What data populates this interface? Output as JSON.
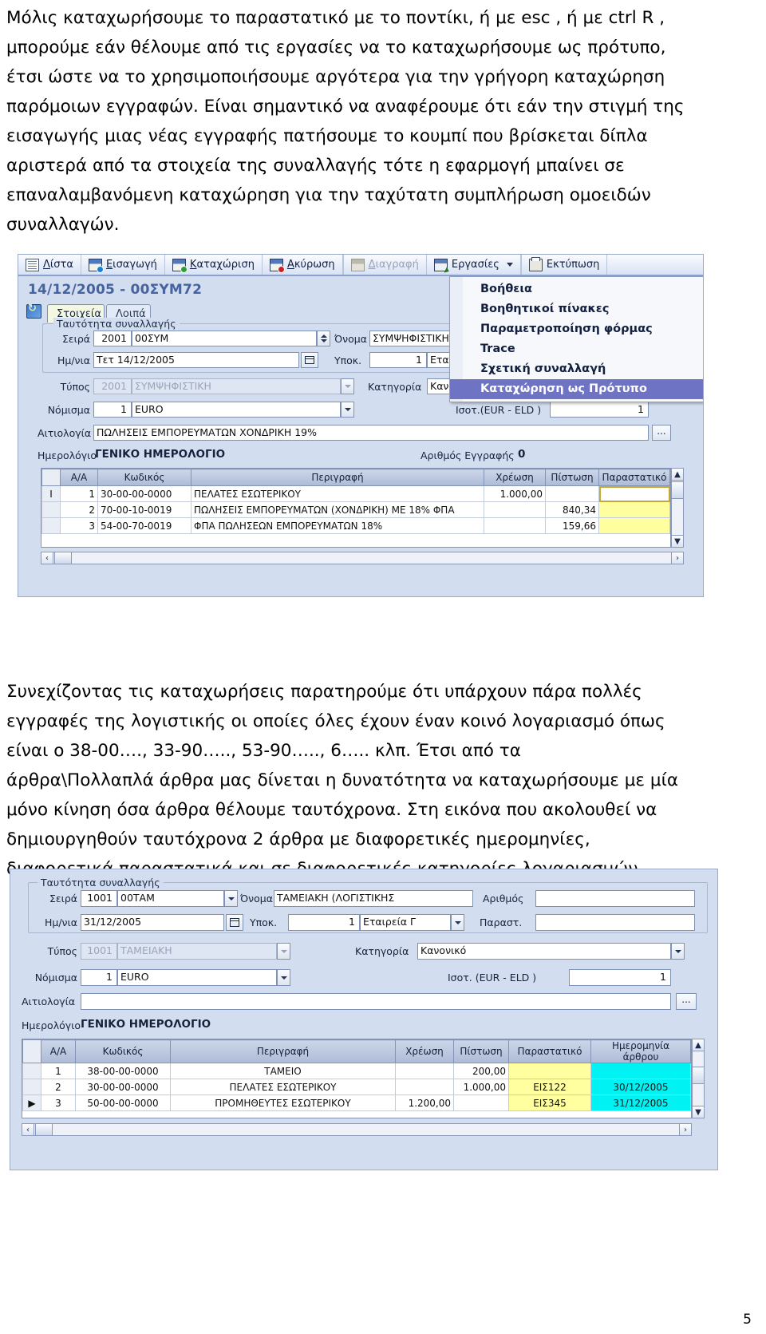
{
  "document": {
    "page_number": "5",
    "paragraph_1": [
      "Μόλις καταχωρήσουμε το παραστατικό με το ποντίκι, ή με esc , ή με ctrl R ,",
      "μπορούμε εάν θέλουμε από τις εργασίες να το καταχωρήσουμε ως πρότυπο,",
      "έτσι ώστε να το χρησιμοποιήσουμε αργότερα για την γρήγορη καταχώρηση",
      "παρόμοιων εγγραφών. Είναι σημαντικό να αναφέρουμε ότι εάν την στιγμή της",
      "εισαγωγής μιας νέας εγγραφής πατήσουμε το κουμπί που βρίσκεται δίπλα",
      "αριστερά από τα στοιχεία της συναλλαγής τότε η εφαρμογή μπαίνει σε",
      "επαναλαμβανόμενη καταχώρηση για την ταχύτατη συμπλήρωση ομοειδών",
      "συναλλαγών."
    ],
    "paragraph_2": [
      "Συνεχίζοντας τις καταχωρήσεις παρατηρούμε ότι υπάρχουν πάρα πολλές",
      "εγγραφές της λογιστικής οι οποίες όλες έχουν έναν κοινό λογαριασμό όπως",
      "είναι ο 38-00…., 33-90….., 53-90….., 6….. κλπ. Έτσι από τα",
      "άρθρα\\Πολλαπλά άρθρα μας δίνεται η δυνατότητα να καταχωρήσουμε με μία",
      "μόνο κίνηση όσα άρθρα θέλουμε ταυτόχρονα. Στη εικόνα που ακολουθεί να",
      "δημιουργηθούν ταυτόχρονα 2 άρθρα με διαφορετικές ημερομηνίες,",
      "διαφορετικά παραστατικά και σε διαφορετικές κατηγορίες λογαριασμών."
    ]
  },
  "screenshot1": {
    "toolbar": [
      {
        "label": "Λίστα",
        "accel": "Λ",
        "icon": "list-icon",
        "disabled": false
      },
      {
        "label": "Εισαγωγή",
        "accel": "Ε",
        "icon": "insert-icon",
        "disabled": false
      },
      {
        "label": "Καταχώριση",
        "accel": "Κ",
        "icon": "save-icon",
        "disabled": false
      },
      {
        "label": "Ακύρωση",
        "accel": "Α",
        "icon": "cancel-icon",
        "disabled": false
      },
      {
        "label": "Διαγραφή",
        "accel": "Δ",
        "icon": "delete-icon",
        "disabled": true
      },
      {
        "label": "Εργασίες",
        "accel": "",
        "icon": "jobs-icon",
        "disabled": false
      },
      {
        "label": "Εκτύπωση",
        "accel": "",
        "icon": "print-icon",
        "disabled": false
      }
    ],
    "record_title": "14/12/2005 - 00ΣΥΜ72",
    "tabs": [
      {
        "label": "Στοιχεία",
        "active": true
      },
      {
        "label": "Λοιπά",
        "active": false
      }
    ],
    "group_legend": "Ταυτότητα συναλλαγής",
    "fields": {
      "seira_label": "Σειρά",
      "seira_code": "2001",
      "seira_value": "00ΣΥΜ",
      "onoma_label": "Όνομα",
      "onoma_value": "ΣΥΜΨΗΦΙΣΤΙΚΗ (Λ",
      "imnia_label": "Ημ/νια",
      "imnia_value": "Τετ 14/12/2005",
      "ypok_label": "Υποκ.",
      "ypok_code": "1",
      "ypok_value": "Εταιρ",
      "typos_label": "Τύπος",
      "typos_code": "2001",
      "typos_value": "ΣΥΜΨΗΦΙΣΤΙΚΗ",
      "katigoria_label": "Κατηγορία",
      "katigoria_value": "Κανονικό",
      "nomisma_label": "Νόμισμα",
      "nomisma_code": "1",
      "nomisma_value": "EURO",
      "isot_label": "Ισοτ.(EUR -   ELD )",
      "isot_value": "1",
      "aitiologia_label": "Αιτιολογία",
      "aitiologia_value": "ΠΩΛΗΣΕΙΣ ΕΜΠΟΡΕΥΜΑΤΩΝ ΧΟΝΔΡΙΚΗ 19%",
      "dots_button": "...",
      "imerologio_label": "Ημερολόγιο",
      "imerologio_value": "ΓΕΝΙΚΟ ΗΜΕΡΟΛΟΓΙΟ",
      "arithmos_label": "Αριθμός Εγγραφής",
      "arithmos_value": "0"
    },
    "menu": {
      "items": [
        {
          "label": "Βοήθεια",
          "selected": false
        },
        {
          "label": "Βοηθητικοί πίνακες",
          "selected": false
        },
        {
          "label": "Παραμετροποίηση φόρμας",
          "selected": false
        },
        {
          "label": "Trace",
          "selected": false
        },
        {
          "label": "Σχετική συναλλαγή",
          "selected": false
        },
        {
          "label": "Καταχώρηση ως Πρότυπο",
          "selected": true
        }
      ]
    },
    "grid": {
      "columns": [
        "Α/Α",
        "Κωδικός",
        "Περιγραφή",
        "Χρέωση",
        "Πίστωση",
        "Παραστατικό"
      ],
      "rows": [
        {
          "aa": "1",
          "code": "30-00-00-0000",
          "desc": "ΠΕΛΑΤΕΣ ΕΣΩΤΕΡΙΚΟΥ",
          "debit": "1.000,00",
          "credit": "",
          "doc": "",
          "doc_style": "focus"
        },
        {
          "aa": "2",
          "code": "70-00-10-0019",
          "desc": "ΠΩΛΗΣΕΙΣ ΕΜΠΟΡΕΥΜΑΤΩΝ (ΧΟΝΔΡΙΚΗ) ΜΕ 18% ΦΠΑ",
          "debit": "",
          "credit": "840,34",
          "doc": "",
          "doc_style": "yellow"
        },
        {
          "aa": "3",
          "code": "54-00-70-0019",
          "desc": "ΦΠΑ ΠΩΛΗΣΕΩΝ ΕΜΠΟΡΕΥΜΑΤΩΝ 18%",
          "debit": "",
          "credit": "159,66",
          "doc": "",
          "doc_style": "yellow"
        }
      ]
    }
  },
  "screenshot2": {
    "group_legend": "Ταυτότητα συναλλαγής",
    "fields": {
      "seira_label": "Σειρά",
      "seira_code": "1001",
      "seira_value": "00ΤΑΜ",
      "onoma_label": "Όνομα",
      "onoma_value": "ΤΑΜΕΙΑΚΗ (ΛΟΓΙΣΤΙΚΗΣ",
      "arithmos_label": "Αριθμός",
      "arithmos_value": "",
      "imnia_label": "Ημ/νια",
      "imnia_value": "31/12/2005",
      "ypok_label": "Υποκ.",
      "ypok_code": "1",
      "ypok_value": "Εταιρεία Γ",
      "parast_label": "Παραστ.",
      "parast_value": "",
      "typos_label": "Τύπος",
      "typos_code": "1001",
      "typos_value": "ΤΑΜΕΙΑΚΗ",
      "katigoria_label": "Κατηγορία",
      "katigoria_value": "Κανονικό",
      "nomisma_label": "Νόμισμα",
      "nomisma_code": "1",
      "nomisma_value": "EURO",
      "isot_label": "Ισοτ. (EUR -  ELD )",
      "isot_value": "1",
      "aitiologia_label": "Αιτιολογία",
      "aitiologia_value": "",
      "dots_button": "...",
      "imerologio_label": "Ημερολόγιο",
      "imerologio_value": "ΓΕΝΙΚΟ ΗΜΕΡΟΛΟΓΙΟ"
    },
    "grid": {
      "columns": [
        "Α/Α",
        "Κωδικός",
        "Περιγραφή",
        "Χρέωση",
        "Πίστωση",
        "Παραστατικό",
        "Ημερομηνία άρθρου"
      ],
      "rows": [
        {
          "aa": "1",
          "code": "38-00-00-0000",
          "desc": "ΤΑΜΕΙΟ",
          "debit": "",
          "credit": "200,00",
          "doc": "",
          "doc_style": "yellow",
          "date": "",
          "date_style": "cyan"
        },
        {
          "aa": "2",
          "code": "30-00-00-0000",
          "desc": "ΠΕΛΑΤΕΣ ΕΣΩΤΕΡΙΚΟΥ",
          "debit": "",
          "credit": "1.000,00",
          "doc": "ΕΙΣ122",
          "doc_style": "yellow",
          "date": "30/12/2005",
          "date_style": "cyan"
        },
        {
          "aa": "3",
          "code": "50-00-00-0000",
          "desc": "ΠΡΟΜΗΘΕΥΤΕΣ ΕΣΩΤΕΡΙΚΟΥ",
          "debit": "1.200,00",
          "credit": "",
          "doc": "ΕΙΣ345",
          "doc_style": "yellow",
          "date": "31/12/2005",
          "date_style": "cyan"
        }
      ]
    }
  },
  "colors": {
    "form_background": "#d3ddf0",
    "menu_selected": "#6f73c4",
    "title_text": "#46639f",
    "cell_yellow": "#ffffa0",
    "cell_cyan": "#00f2f2"
  }
}
